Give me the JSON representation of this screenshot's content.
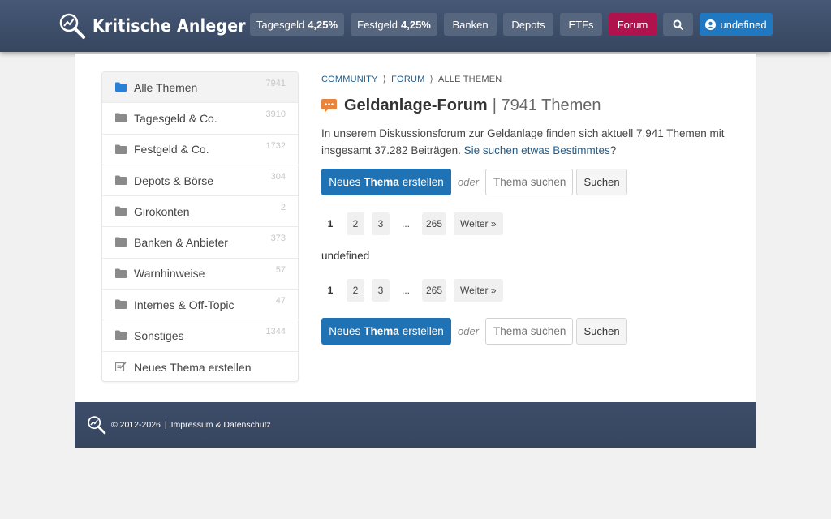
{
  "header": {
    "logo_text": "Kritische Anleger",
    "nav": [
      {
        "label": "Tagesgeld",
        "value": "4,25%"
      },
      {
        "label": "Festgeld",
        "value": "4,25%"
      },
      {
        "label": "Banken"
      },
      {
        "label": "Depots"
      },
      {
        "label": "ETFs"
      },
      {
        "label": "Forum",
        "active": true
      }
    ],
    "search_icon": "search-icon",
    "user_label": "undefined"
  },
  "sidebar": {
    "items": [
      {
        "label": "Alle Themen",
        "count": "7941",
        "icon": "folder-icon",
        "active": true
      },
      {
        "label": "Tagesgeld & Co.",
        "count": "3910",
        "icon": "folder-icon"
      },
      {
        "label": "Festgeld & Co.",
        "count": "1732",
        "icon": "folder-icon"
      },
      {
        "label": "Depots & Börse",
        "count": "304",
        "icon": "folder-icon"
      },
      {
        "label": "Girokonten",
        "count": "2",
        "icon": "folder-icon"
      },
      {
        "label": "Banken & Anbieter",
        "count": "373",
        "icon": "folder-icon"
      },
      {
        "label": "Warnhinweise",
        "count": "57",
        "icon": "folder-icon"
      },
      {
        "label": "Internes & Off-Topic",
        "count": "47",
        "icon": "folder-icon"
      },
      {
        "label": "Sonstiges",
        "count": "1344",
        "icon": "folder-icon"
      },
      {
        "label": "Neues Thema erstellen",
        "count": "",
        "icon": "edit-icon"
      }
    ]
  },
  "breadcrumb": {
    "items": [
      "COMMUNITY",
      "FORUM"
    ],
    "current": "ALLE THEMEN"
  },
  "page": {
    "title": "Geldanlage-Forum",
    "subtitle": "| 7941 Themen",
    "intro": "In unserem Diskussionsforum zur Geldanlage finden sich aktuell 7.941 Themen mit insgesamt 37.282 Beiträgen.",
    "intro_link": "Sie suchen etwas Bestimmtes",
    "intro_end": "?",
    "content_text": "undefined"
  },
  "actions": {
    "new_prefix": "Neues",
    "new_bold": "Thema",
    "new_suffix": "erstellen",
    "or": "oder",
    "search_placeholder": "Thema suchen",
    "search_button": "Suchen"
  },
  "pagination": {
    "pages": [
      "1",
      "2",
      "3",
      "...",
      "265"
    ],
    "current": "1",
    "next": "Weiter »"
  },
  "footer": {
    "copyright": "© 2012-2026",
    "separator": "|",
    "link": "Impressum & Datenschutz"
  },
  "colors": {
    "header_bg": "#3e4f6c",
    "nav_button": "#56667f",
    "forum_active": "#b0124d",
    "user_button": "#1f78c0",
    "primary_button": "#1f73b4",
    "link": "#215e8e",
    "forum_icon": "#e8843c"
  }
}
